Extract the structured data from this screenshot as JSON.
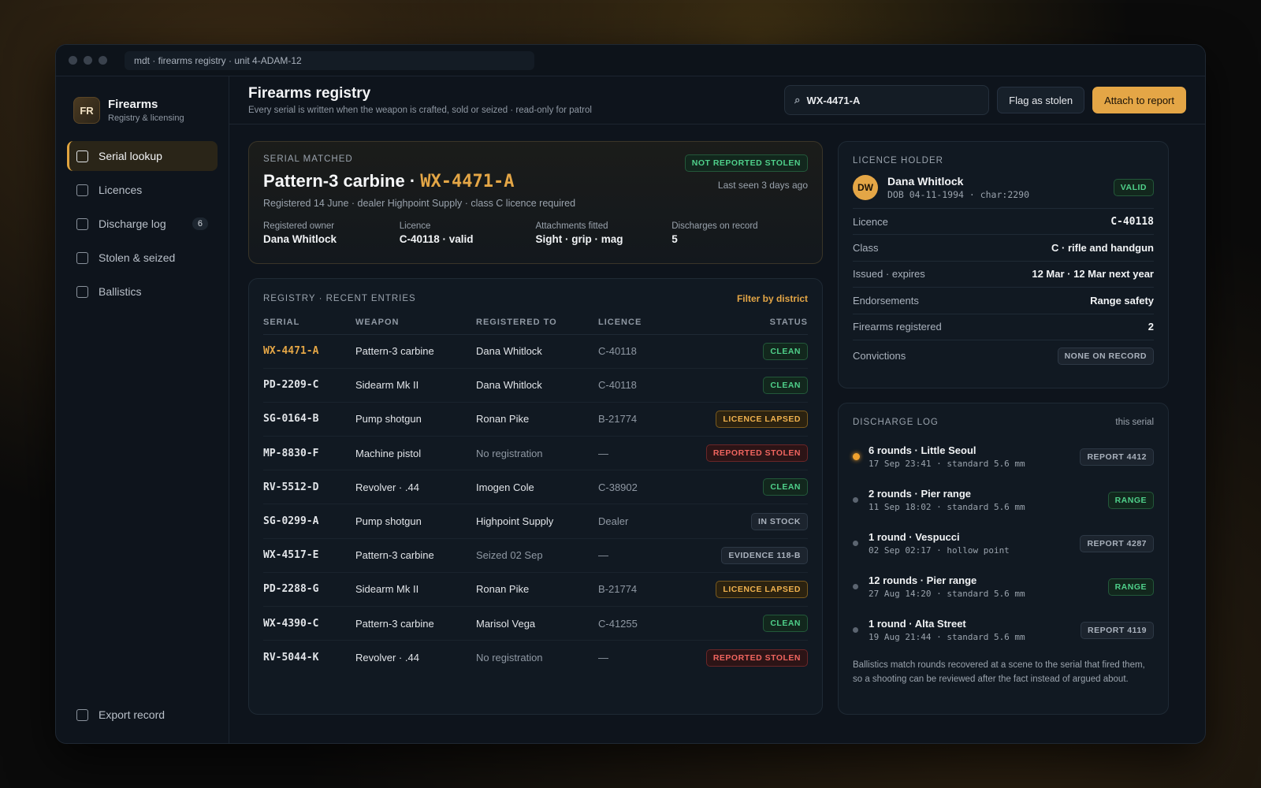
{
  "window": {
    "address": "mdt · firearms registry · unit 4-ADAM-12"
  },
  "brand": {
    "mark": "FR",
    "title": "Firearms",
    "subtitle": "Registry & licensing"
  },
  "nav": [
    {
      "label": "Serial lookup",
      "active": true
    },
    {
      "label": "Licences"
    },
    {
      "label": "Discharge log",
      "count": "6"
    },
    {
      "label": "Stolen & seized"
    },
    {
      "label": "Ballistics"
    }
  ],
  "export_label": "Export record",
  "header": {
    "title": "Firearms registry",
    "subtitle": "Every serial is written when the weapon is crafted, sold or seized · read-only for patrol",
    "search_value": "WX-4471-A",
    "flag_label": "Flag as stolen",
    "attach_label": "Attach to report"
  },
  "match": {
    "eyebrow": "Serial matched",
    "weapon": "Pattern-3 carbine ·",
    "serial": "WX-4471-A",
    "badge": "Not reported stolen",
    "last_seen": "Last seen 3 days ago",
    "description": "Registered 14 June · dealer Highpoint Supply · class C licence required",
    "facts": [
      {
        "label": "Registered owner",
        "value": "Dana Whitlock"
      },
      {
        "label": "Licence",
        "value": "C-40118 · valid"
      },
      {
        "label": "Attachments fitted",
        "value": "Sight · grip · mag"
      },
      {
        "label": "Discharges on record",
        "value": "5"
      }
    ]
  },
  "registry": {
    "title": "Registry · recent entries",
    "filter_label": "Filter by district",
    "columns": [
      "Serial",
      "Weapon",
      "Registered to",
      "Licence",
      "Status"
    ],
    "rows": [
      {
        "serial": "WX-4471-A",
        "weapon": "Pattern-3 carbine",
        "owner": "Dana Whitlock",
        "licence": "C-40118",
        "status": "Clean",
        "tone": "green",
        "highlight": true
      },
      {
        "serial": "PD-2209-C",
        "weapon": "Sidearm Mk II",
        "owner": "Dana Whitlock",
        "licence": "C-40118",
        "status": "Clean",
        "tone": "green"
      },
      {
        "serial": "SG-0164-B",
        "weapon": "Pump shotgun",
        "owner": "Ronan Pike",
        "licence": "B-21774",
        "status": "Licence lapsed",
        "tone": "amber"
      },
      {
        "serial": "MP-8830-F",
        "weapon": "Machine pistol",
        "owner": "No registration",
        "owner_muted": true,
        "licence": "—",
        "status": "Reported stolen",
        "tone": "red"
      },
      {
        "serial": "RV-5512-D",
        "weapon": "Revolver · .44",
        "owner": "Imogen Cole",
        "licence": "C-38902",
        "status": "Clean",
        "tone": "green"
      },
      {
        "serial": "SG-0299-A",
        "weapon": "Pump shotgun",
        "owner": "Highpoint Supply",
        "licence": "Dealer",
        "status": "In stock",
        "tone": "grey"
      },
      {
        "serial": "WX-4517-E",
        "weapon": "Pattern-3 carbine",
        "owner": "Seized 02 Sep",
        "owner_muted": true,
        "licence": "—",
        "status": "Evidence 118-B",
        "tone": "grey"
      },
      {
        "serial": "PD-2288-G",
        "weapon": "Sidearm Mk II",
        "owner": "Ronan Pike",
        "licence": "B-21774",
        "status": "Licence lapsed",
        "tone": "amber"
      },
      {
        "serial": "WX-4390-C",
        "weapon": "Pattern-3 carbine",
        "owner": "Marisol Vega",
        "licence": "C-41255",
        "status": "Clean",
        "tone": "green"
      },
      {
        "serial": "RV-5044-K",
        "weapon": "Revolver · .44",
        "owner": "No registration",
        "owner_muted": true,
        "licence": "—",
        "status": "Reported stolen",
        "tone": "red"
      }
    ]
  },
  "holder": {
    "title": "Licence holder",
    "initials": "DW",
    "name": "Dana Whitlock",
    "dob": "DOB 04-11-1994 · char:2290",
    "badge": "Valid",
    "fields": [
      {
        "k": "Licence",
        "v": "C-40118",
        "mono": true
      },
      {
        "k": "Class",
        "v": "C · rifle and handgun"
      },
      {
        "k": "Issued · expires",
        "v": "12 Mar · 12 Mar next year"
      },
      {
        "k": "Endorsements",
        "v": "Range safety"
      },
      {
        "k": "Firearms registered",
        "v": "2"
      },
      {
        "k": "Convictions",
        "v": "None on record",
        "badge": true
      }
    ]
  },
  "discharge": {
    "title": "Discharge log",
    "note": "this serial",
    "entries": [
      {
        "title": "6 rounds · Little Seoul",
        "sub": "17 Sep 23:41 · standard 5.6 mm",
        "tag": "Report 4412",
        "tone": "grey",
        "hot": true
      },
      {
        "title": "2 rounds · Pier range",
        "sub": "11 Sep 18:02 · standard 5.6 mm",
        "tag": "Range",
        "tone": "green"
      },
      {
        "title": "1 round · Vespucci",
        "sub": "02 Sep 02:17 · hollow point",
        "tag": "Report 4287",
        "tone": "grey"
      },
      {
        "title": "12 rounds · Pier range",
        "sub": "27 Aug 14:20 · standard 5.6 mm",
        "tag": "Range",
        "tone": "green"
      },
      {
        "title": "1 round · Alta Street",
        "sub": "19 Aug 21:44 · standard 5.6 mm",
        "tag": "Report 4119",
        "tone": "grey"
      }
    ],
    "footnote": "Ballistics match rounds recovered at a scene to the serial that fired them, so a shooting can be reviewed after the fact instead of argued about."
  },
  "colors": {
    "accent": "#e4a646",
    "green": "#4fd08a",
    "red": "#f0655f",
    "amber": "#f0b24e"
  }
}
